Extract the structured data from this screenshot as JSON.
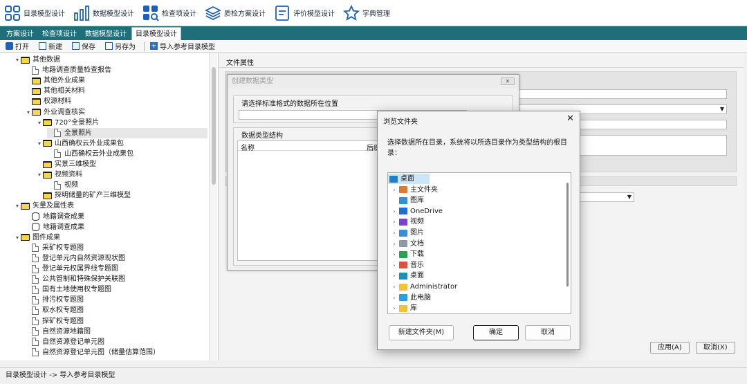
{
  "ribbon": {
    "items": [
      {
        "label": "目录模型设计",
        "icon": "grid-icon"
      },
      {
        "label": "数据模型设计",
        "icon": "bar-chart-icon"
      },
      {
        "label": "检查项设计",
        "icon": "search-grid-icon"
      },
      {
        "label": "质检方案设计",
        "icon": "layers-icon"
      },
      {
        "label": "评价模型设计",
        "icon": "document-icon"
      },
      {
        "label": "字典管理",
        "icon": "star-icon"
      }
    ]
  },
  "tabs": [
    {
      "label": "方案设计"
    },
    {
      "label": "检查项设计"
    },
    {
      "label": "数据模型设计"
    },
    {
      "label": "目录模型设计",
      "active": true
    }
  ],
  "toolbar": {
    "open": "打开",
    "new": "新建",
    "save": "保存",
    "save_as": "另存为",
    "import": "导入参考目录模型"
  },
  "tree": [
    {
      "label": "其他数据",
      "icon": "folder",
      "arrow": "down"
    },
    {
      "label": "地籍调查质量检查报告",
      "icon": "doc"
    },
    {
      "label": "其他外业成果",
      "icon": "folder"
    },
    {
      "label": "其他相关材料",
      "icon": "folder"
    },
    {
      "label": "权源材料",
      "icon": "folder"
    },
    {
      "label": "外业调查核实",
      "icon": "folder",
      "arrow": "down"
    },
    {
      "label": "720°全景照片",
      "icon": "folder",
      "arrow": "down"
    },
    {
      "label": "全景照片",
      "icon": "doc",
      "selected": true
    },
    {
      "label": "山西确权云外业成果包",
      "icon": "folder",
      "arrow": "down"
    },
    {
      "label": "山西确权云外业成果包",
      "icon": "doc"
    },
    {
      "label": "实景三维模型",
      "icon": "folder"
    },
    {
      "label": "视频资料",
      "icon": "folder",
      "arrow": "down"
    },
    {
      "label": "视频",
      "icon": "doc"
    },
    {
      "label": "探明储量的矿产三维模型",
      "icon": "folder"
    },
    {
      "label": "矢量及属性表",
      "icon": "folder",
      "arrow": "down"
    },
    {
      "label": "地籍调查成果",
      "icon": "db"
    },
    {
      "label": "地籍调查成果",
      "icon": "db"
    },
    {
      "label": "图件成果",
      "icon": "folder",
      "arrow": "down"
    },
    {
      "label": "采矿权专题图",
      "icon": "doc"
    },
    {
      "label": "登记单元内自然资源现状图",
      "icon": "doc"
    },
    {
      "label": "登记单元权属界线专题图",
      "icon": "doc"
    },
    {
      "label": "公共管制和特殊保护关联图",
      "icon": "doc"
    },
    {
      "label": "国有土地使用权专题图",
      "icon": "doc"
    },
    {
      "label": "排污权专题图",
      "icon": "doc"
    },
    {
      "label": "取水权专题图",
      "icon": "doc"
    },
    {
      "label": "探矿权专题图",
      "icon": "doc"
    },
    {
      "label": "自然资源地籍图",
      "icon": "doc"
    },
    {
      "label": "自然资源登记单元图",
      "icon": "doc"
    },
    {
      "label": "自然资源登记单元图（储量估算范围）",
      "icon": "doc"
    }
  ],
  "right": {
    "title": "文件属性",
    "apply": "应用(A)",
    "cancel": "取消(X)"
  },
  "bg_dialog": {
    "title": "创建数据类型",
    "location_label": "请选择标准格式的数据所在位置",
    "structure_label": "数据类型结构",
    "col_name": "名称",
    "col_suffix": "后缀"
  },
  "dialog": {
    "title": "浏览文件夹",
    "description": "选择数据所在目录，系统将以所选目录作为类型结构的根目录：",
    "folders": [
      {
        "label": "桌面",
        "color": "#1f7fc8",
        "chevron": false,
        "selected": true,
        "level": 0
      },
      {
        "label": "主文件夹",
        "color": "#e07a2d",
        "chevron": true,
        "level": 1
      },
      {
        "label": "图库",
        "color": "#2f8fd8",
        "chevron": false,
        "level": 1
      },
      {
        "label": "OneDrive",
        "color": "#1e6fd0",
        "chevron": true,
        "level": 1
      },
      {
        "label": "视频",
        "color": "#7a45c8",
        "chevron": true,
        "level": 1
      },
      {
        "label": "图片",
        "color": "#3a8ed8",
        "chevron": true,
        "level": 1
      },
      {
        "label": "文档",
        "color": "#8a9aa8",
        "chevron": true,
        "level": 1
      },
      {
        "label": "下载",
        "color": "#2ba050",
        "chevron": true,
        "level": 1
      },
      {
        "label": "音乐",
        "color": "#e0503a",
        "chevron": true,
        "level": 1
      },
      {
        "label": "桌面",
        "color": "#1f8fb8",
        "chevron": true,
        "level": 1
      },
      {
        "label": "Administrator",
        "color": "#f2c23a",
        "chevron": true,
        "level": 1
      },
      {
        "label": "此电脑",
        "color": "#2f9fd8",
        "chevron": true,
        "level": 1
      },
      {
        "label": "库",
        "color": "#f2c23a",
        "chevron": true,
        "level": 1
      }
    ],
    "new_folder": "新建文件夹(M)",
    "ok": "确定",
    "cancel": "取消"
  },
  "status": {
    "text": "目录模型设计 -> 导入参考目录模型"
  }
}
